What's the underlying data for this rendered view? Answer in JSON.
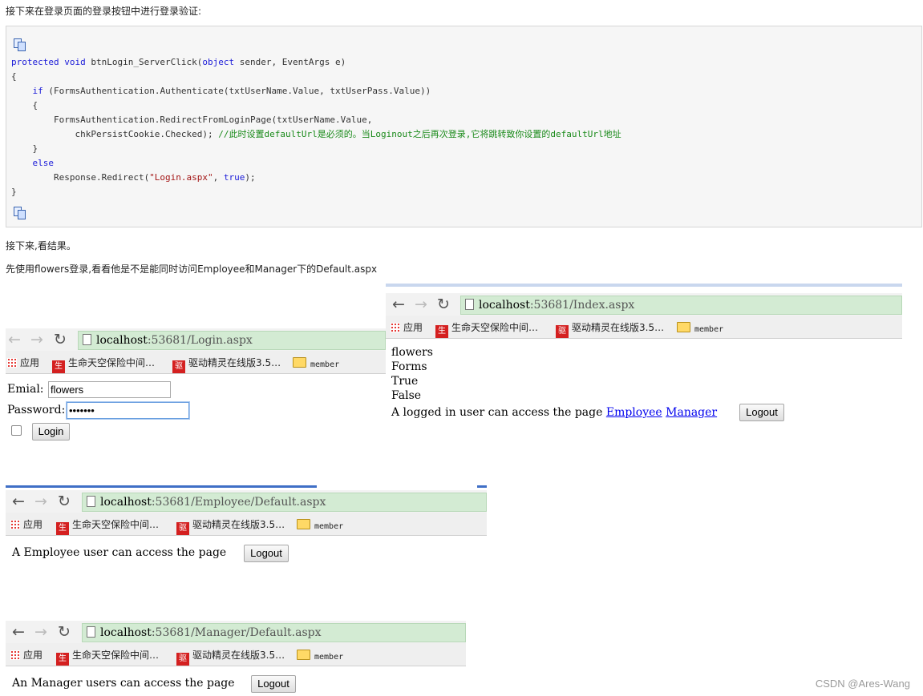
{
  "intro": "接下来在登录页面的登录按钮中进行登录验证:",
  "code": {
    "lines": [
      [
        {
          "t": "protected void",
          "c": "kw"
        },
        {
          "t": " btnLogin_ServerClick("
        },
        {
          "t": "object",
          "c": "kw"
        },
        {
          "t": " sender, EventArgs e)"
        }
      ],
      [
        {
          "t": "{"
        }
      ],
      [
        {
          "t": "    "
        },
        {
          "t": "if",
          "c": "kw"
        },
        {
          "t": " (FormsAuthentication.Authenticate(txtUserName.Value, txtUserPass.Value))"
        }
      ],
      [
        {
          "t": "    {"
        }
      ],
      [
        {
          "t": "        FormsAuthentication.RedirectFromLoginPage(txtUserName.Value,"
        }
      ],
      [
        {
          "t": "            chkPersistCookie.Checked); "
        },
        {
          "t": "//此时设置defaultUrl是必须的。当Loginout之后再次登录,它将跳转致你设置的defaultUrl地址",
          "c": "cmt"
        }
      ],
      [
        {
          "t": "    }"
        }
      ],
      [
        {
          "t": "    "
        },
        {
          "t": "else",
          "c": "kw"
        }
      ],
      [
        {
          "t": "        Response.Redirect("
        },
        {
          "t": "\"Login.aspx\"",
          "c": "str"
        },
        {
          "t": ", "
        },
        {
          "t": "true",
          "c": "kw"
        },
        {
          "t": ");"
        }
      ],
      [
        {
          "t": "}"
        }
      ]
    ],
    "copy_icon": "copy-icon"
  },
  "para2": "接下来,看结果。",
  "para3": "先使用flowers登录,看看他是不是能同时访问Employee和Manager下的Default.aspx",
  "bookmarks": {
    "apps": "应用",
    "b1": "生命天空保险中间…",
    "b2": "驱动精灵在线版3.5…",
    "b3": "member"
  },
  "login_window": {
    "url_host": "localhost",
    "url_rest": ":53681/Login.aspx",
    "email_label": "Emial:",
    "email_value": "flowers",
    "password_label": "Password:",
    "password_value": "•••••••",
    "login_button": "Login"
  },
  "index_window": {
    "url_host": "localhost",
    "url_rest": ":53681/Index.aspx",
    "line1": "flowers",
    "line2": "Forms",
    "line3": "True",
    "line4": "False",
    "access_text": "A logged in user can access the page",
    "link_employee": "Employee",
    "link_manager": "Manager",
    "logout_button": "Logout"
  },
  "employee_window": {
    "url_host": "localhost",
    "url_rest": ":53681/Employee/Default.aspx",
    "access_text": "A Employee user can access the page",
    "logout_button": "Logout"
  },
  "manager_window": {
    "url_host": "localhost",
    "url_rest": ":53681/Manager/Default.aspx",
    "access_text": "An Manager users can access the page",
    "logout_button": "Logout"
  },
  "watermark": "CSDN @Ares-Wang"
}
